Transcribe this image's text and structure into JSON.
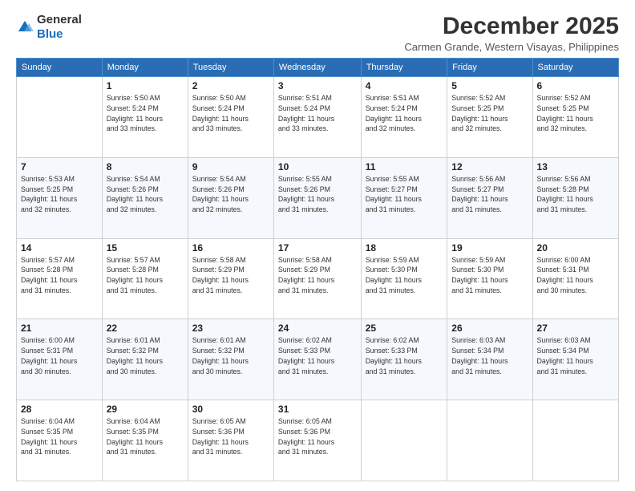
{
  "header": {
    "logo_general": "General",
    "logo_blue": "Blue",
    "month_year": "December 2025",
    "location": "Carmen Grande, Western Visayas, Philippines"
  },
  "days_of_week": [
    "Sunday",
    "Monday",
    "Tuesday",
    "Wednesday",
    "Thursday",
    "Friday",
    "Saturday"
  ],
  "weeks": [
    [
      {
        "day": "",
        "info": ""
      },
      {
        "day": "1",
        "info": "Sunrise: 5:50 AM\nSunset: 5:24 PM\nDaylight: 11 hours\nand 33 minutes."
      },
      {
        "day": "2",
        "info": "Sunrise: 5:50 AM\nSunset: 5:24 PM\nDaylight: 11 hours\nand 33 minutes."
      },
      {
        "day": "3",
        "info": "Sunrise: 5:51 AM\nSunset: 5:24 PM\nDaylight: 11 hours\nand 33 minutes."
      },
      {
        "day": "4",
        "info": "Sunrise: 5:51 AM\nSunset: 5:24 PM\nDaylight: 11 hours\nand 32 minutes."
      },
      {
        "day": "5",
        "info": "Sunrise: 5:52 AM\nSunset: 5:25 PM\nDaylight: 11 hours\nand 32 minutes."
      },
      {
        "day": "6",
        "info": "Sunrise: 5:52 AM\nSunset: 5:25 PM\nDaylight: 11 hours\nand 32 minutes."
      }
    ],
    [
      {
        "day": "7",
        "info": "Sunrise: 5:53 AM\nSunset: 5:25 PM\nDaylight: 11 hours\nand 32 minutes."
      },
      {
        "day": "8",
        "info": "Sunrise: 5:54 AM\nSunset: 5:26 PM\nDaylight: 11 hours\nand 32 minutes."
      },
      {
        "day": "9",
        "info": "Sunrise: 5:54 AM\nSunset: 5:26 PM\nDaylight: 11 hours\nand 32 minutes."
      },
      {
        "day": "10",
        "info": "Sunrise: 5:55 AM\nSunset: 5:26 PM\nDaylight: 11 hours\nand 31 minutes."
      },
      {
        "day": "11",
        "info": "Sunrise: 5:55 AM\nSunset: 5:27 PM\nDaylight: 11 hours\nand 31 minutes."
      },
      {
        "day": "12",
        "info": "Sunrise: 5:56 AM\nSunset: 5:27 PM\nDaylight: 11 hours\nand 31 minutes."
      },
      {
        "day": "13",
        "info": "Sunrise: 5:56 AM\nSunset: 5:28 PM\nDaylight: 11 hours\nand 31 minutes."
      }
    ],
    [
      {
        "day": "14",
        "info": "Sunrise: 5:57 AM\nSunset: 5:28 PM\nDaylight: 11 hours\nand 31 minutes."
      },
      {
        "day": "15",
        "info": "Sunrise: 5:57 AM\nSunset: 5:28 PM\nDaylight: 11 hours\nand 31 minutes."
      },
      {
        "day": "16",
        "info": "Sunrise: 5:58 AM\nSunset: 5:29 PM\nDaylight: 11 hours\nand 31 minutes."
      },
      {
        "day": "17",
        "info": "Sunrise: 5:58 AM\nSunset: 5:29 PM\nDaylight: 11 hours\nand 31 minutes."
      },
      {
        "day": "18",
        "info": "Sunrise: 5:59 AM\nSunset: 5:30 PM\nDaylight: 11 hours\nand 31 minutes."
      },
      {
        "day": "19",
        "info": "Sunrise: 5:59 AM\nSunset: 5:30 PM\nDaylight: 11 hours\nand 31 minutes."
      },
      {
        "day": "20",
        "info": "Sunrise: 6:00 AM\nSunset: 5:31 PM\nDaylight: 11 hours\nand 30 minutes."
      }
    ],
    [
      {
        "day": "21",
        "info": "Sunrise: 6:00 AM\nSunset: 5:31 PM\nDaylight: 11 hours\nand 30 minutes."
      },
      {
        "day": "22",
        "info": "Sunrise: 6:01 AM\nSunset: 5:32 PM\nDaylight: 11 hours\nand 30 minutes."
      },
      {
        "day": "23",
        "info": "Sunrise: 6:01 AM\nSunset: 5:32 PM\nDaylight: 11 hours\nand 30 minutes."
      },
      {
        "day": "24",
        "info": "Sunrise: 6:02 AM\nSunset: 5:33 PM\nDaylight: 11 hours\nand 31 minutes."
      },
      {
        "day": "25",
        "info": "Sunrise: 6:02 AM\nSunset: 5:33 PM\nDaylight: 11 hours\nand 31 minutes."
      },
      {
        "day": "26",
        "info": "Sunrise: 6:03 AM\nSunset: 5:34 PM\nDaylight: 11 hours\nand 31 minutes."
      },
      {
        "day": "27",
        "info": "Sunrise: 6:03 AM\nSunset: 5:34 PM\nDaylight: 11 hours\nand 31 minutes."
      }
    ],
    [
      {
        "day": "28",
        "info": "Sunrise: 6:04 AM\nSunset: 5:35 PM\nDaylight: 11 hours\nand 31 minutes."
      },
      {
        "day": "29",
        "info": "Sunrise: 6:04 AM\nSunset: 5:35 PM\nDaylight: 11 hours\nand 31 minutes."
      },
      {
        "day": "30",
        "info": "Sunrise: 6:05 AM\nSunset: 5:36 PM\nDaylight: 11 hours\nand 31 minutes."
      },
      {
        "day": "31",
        "info": "Sunrise: 6:05 AM\nSunset: 5:36 PM\nDaylight: 11 hours\nand 31 minutes."
      },
      {
        "day": "",
        "info": ""
      },
      {
        "day": "",
        "info": ""
      },
      {
        "day": "",
        "info": ""
      }
    ]
  ]
}
